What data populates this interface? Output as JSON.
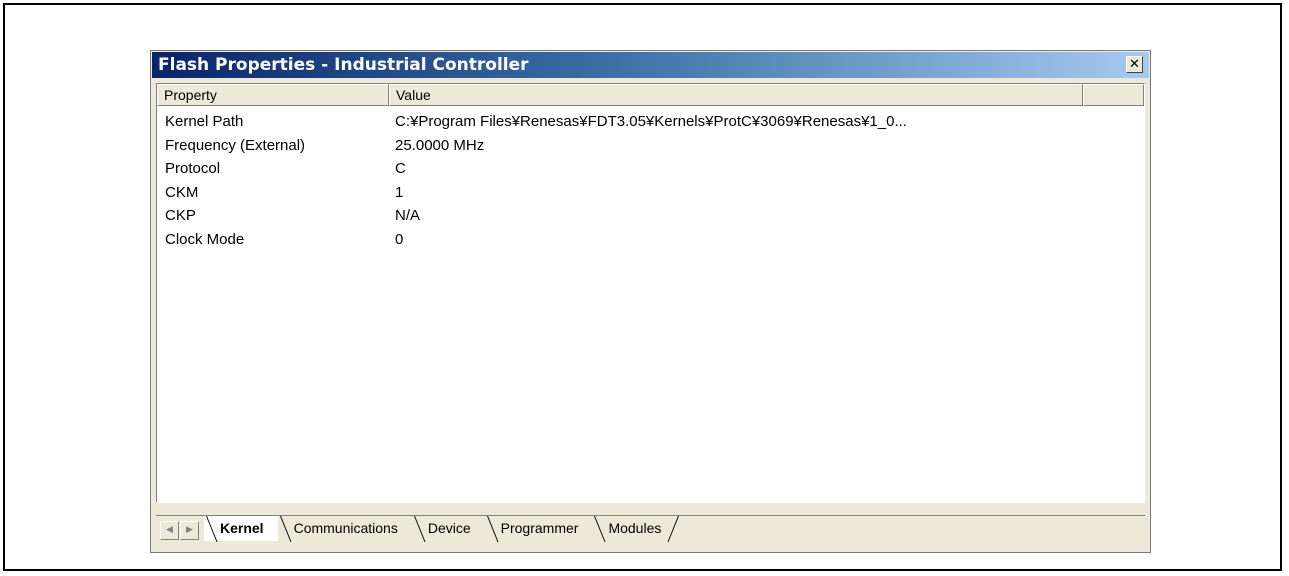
{
  "window": {
    "title": "Flash Properties - Industrial Controller",
    "close_label": "✕"
  },
  "table": {
    "columns": [
      "Property",
      "Value"
    ],
    "rows": [
      {
        "name": "Kernel Path",
        "value": "C:¥Program Files¥Renesas¥FDT3.05¥Kernels¥ProtC¥3069¥Renesas¥1_0..."
      },
      {
        "name": "Frequency (External)",
        "value": "25.0000 MHz"
      },
      {
        "name": "Protocol",
        "value": "C"
      },
      {
        "name": "CKM",
        "value": "1"
      },
      {
        "name": "CKP",
        "value": "N/A"
      },
      {
        "name": "Clock Mode",
        "value": "0"
      }
    ]
  },
  "tabs": {
    "scroll_left": "◀",
    "scroll_right": "▶",
    "items": [
      {
        "label": "Kernel",
        "active": true
      },
      {
        "label": "Communications",
        "active": false
      },
      {
        "label": "Device",
        "active": false
      },
      {
        "label": "Programmer",
        "active": false
      },
      {
        "label": "Modules",
        "active": false
      }
    ]
  }
}
